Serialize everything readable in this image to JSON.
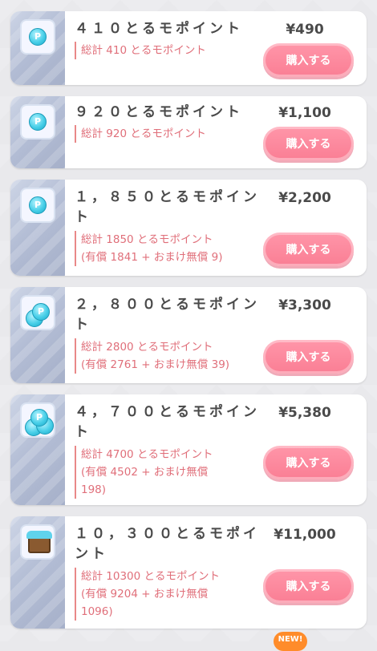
{
  "items": [
    {
      "title": "４１０とるモポイント",
      "price": "¥490",
      "desc": [
        "総計 410 とるモポイント"
      ],
      "buy": "購入する",
      "icon": "coin-icon"
    },
    {
      "title": "９２０とるモポイント",
      "price": "¥1,100",
      "desc": [
        "総計 920 とるモポイント"
      ],
      "buy": "購入する",
      "icon": "coin-icon"
    },
    {
      "title": "１，８５０とるモポイント",
      "price": "¥2,200",
      "desc": [
        "総計 1850 とるモポイント",
        "(有償 1841 + おまけ無償 9)"
      ],
      "buy": "購入する",
      "icon": "coin-icon"
    },
    {
      "title": "２，８００とるモポイント",
      "price": "¥3,300",
      "desc": [
        "総計 2800 とるモポイント",
        "(有償 2761 + おまけ無償 39)"
      ],
      "buy": "購入する",
      "icon": "coin-stack-icon"
    },
    {
      "title": "４，７００とるモポイント",
      "price": "¥5,380",
      "desc": [
        "総計 4700 とるモポイント",
        "(有償 4502 + おまけ無償",
        "198)"
      ],
      "buy": "購入する",
      "icon": "coin-pile-icon"
    },
    {
      "title": "１０，３００とるモポイント",
      "price": "¥11,000",
      "desc": [
        "総計 10300 とるモポイント",
        "(有償 9204 + おまけ無償",
        "1096)"
      ],
      "buy": "購入する",
      "icon": "treasure-chest-icon"
    }
  ],
  "badge": "NEW!",
  "colors": {
    "accent": "#fa7e94",
    "text": "#4a4a4a",
    "desc": "#e06f7a"
  }
}
